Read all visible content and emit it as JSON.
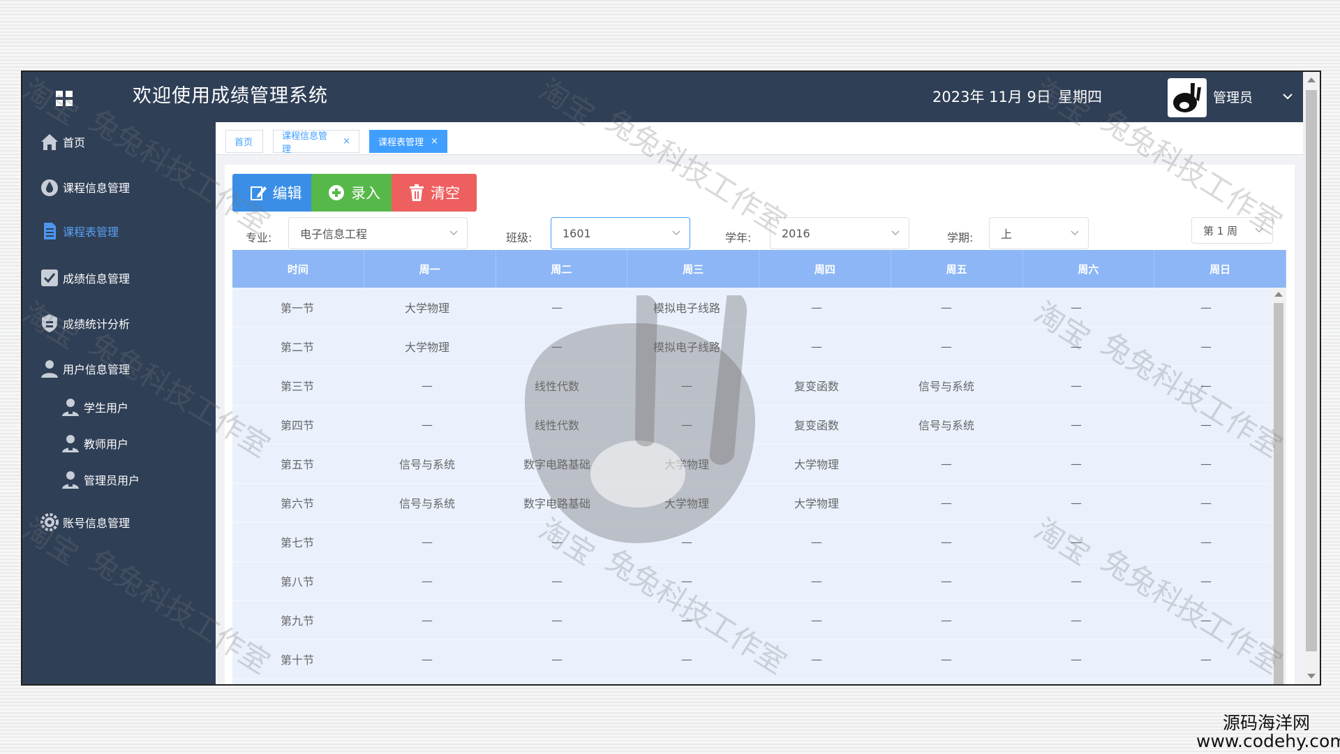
{
  "header": {
    "title": "欢迎使用成绩管理系统",
    "date": "2023年 11月 9日",
    "weekday": "星期四",
    "user": "管理员"
  },
  "sidebar": {
    "items": [
      {
        "label": "首页",
        "icon": "home-icon"
      },
      {
        "label": "课程信息管理",
        "icon": "drop-icon"
      },
      {
        "label": "课程表管理",
        "icon": "document-icon",
        "active": true
      },
      {
        "label": "成绩信息管理",
        "icon": "checkbox-icon"
      },
      {
        "label": "成绩统计分析",
        "icon": "shield-icon"
      },
      {
        "label": "用户信息管理",
        "icon": "user-icon"
      },
      {
        "label": "学生用户",
        "icon": "user-badge-icon"
      },
      {
        "label": "教师用户",
        "icon": "user-badge-icon"
      },
      {
        "label": "管理员用户",
        "icon": "user-badge-icon"
      },
      {
        "label": "账号信息管理",
        "icon": "gear-icon"
      }
    ]
  },
  "tabs": [
    {
      "label": "首页"
    },
    {
      "label": "课程信息管理",
      "close": "×"
    },
    {
      "label": "课程表管理",
      "close": "×",
      "active": true
    }
  ],
  "toolbar": {
    "edit": "编辑",
    "add": "录入",
    "clear": "清空"
  },
  "filters": {
    "major_label": "专业:",
    "major_value": "电子信息工程",
    "class_label": "班级:",
    "class_value": "1601",
    "year_label": "学年:",
    "year_value": "2016",
    "term_label": "学期:",
    "term_value": "上",
    "week_value": "第 1 周"
  },
  "schedule": {
    "headers": [
      "时间",
      "周一",
      "周二",
      "周三",
      "周四",
      "周五",
      "周六",
      "周日"
    ],
    "rows": [
      [
        "第一节",
        "大学物理",
        "—",
        "模拟电子线路",
        "—",
        "—",
        "—",
        "—"
      ],
      [
        "第二节",
        "大学物理",
        "—",
        "模拟电子线路",
        "—",
        "—",
        "—",
        "—"
      ],
      [
        "第三节",
        "—",
        "线性代数",
        "—",
        "复变函数",
        "信号与系统",
        "—",
        "—"
      ],
      [
        "第四节",
        "—",
        "线性代数",
        "—",
        "复变函数",
        "信号与系统",
        "—",
        "—"
      ],
      [
        "第五节",
        "信号与系统",
        "数字电路基础",
        "大学物理",
        "大学物理",
        "—",
        "—",
        "—"
      ],
      [
        "第六节",
        "信号与系统",
        "数字电路基础",
        "大学物理",
        "大学物理",
        "—",
        "—",
        "—"
      ],
      [
        "第七节",
        "—",
        "—",
        "—",
        "—",
        "—",
        "—",
        "—"
      ],
      [
        "第八节",
        "—",
        "—",
        "—",
        "—",
        "—",
        "—",
        "—"
      ],
      [
        "第九节",
        "—",
        "—",
        "—",
        "—",
        "—",
        "—",
        "—"
      ],
      [
        "第十节",
        "—",
        "—",
        "—",
        "—",
        "—",
        "—",
        "—"
      ]
    ]
  },
  "watermark": {
    "text1": "淘宝",
    "text2": "兔兔科技工作室"
  },
  "footer": {
    "brand": "源码海洋网",
    "url": "www.codehy.com"
  }
}
